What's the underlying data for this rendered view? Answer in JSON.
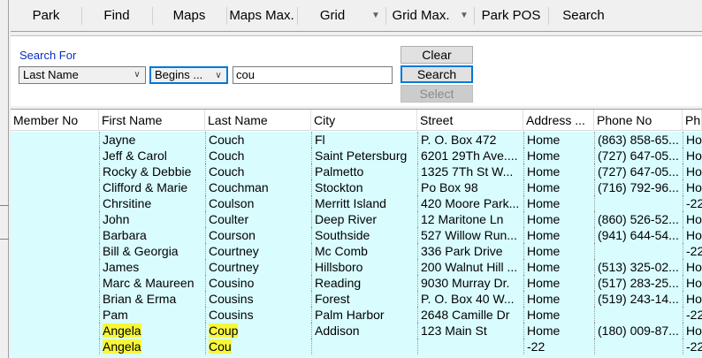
{
  "toolbar": {
    "park": "Park",
    "find": "Find",
    "maps": "Maps",
    "maps_max": "Maps Max.",
    "grid": "Grid",
    "grid_max": "Grid Max.",
    "park_pos": "Park POS",
    "search": "Search"
  },
  "search": {
    "label": "Search For",
    "field": "Last Name",
    "mode": "Begins ...",
    "value": "cou",
    "clear_label": "Clear",
    "search_label": "Search",
    "select_label": "Select"
  },
  "grid": {
    "columns": [
      "Member No",
      "First Name",
      "Last Name",
      "City",
      "Street",
      "Address ...",
      "Phone No",
      "Ph"
    ],
    "rows": [
      {
        "member": "",
        "first": "Jayne",
        "last": "Couch",
        "city": "Fl",
        "street": "P. O. Box 472",
        "addr": "Home",
        "phone": "(863) 858-65...",
        "ph": "Ho",
        "hl_first": false,
        "hl_last": false
      },
      {
        "member": "",
        "first": "Jeff & Carol",
        "last": "Couch",
        "city": "Saint Petersburg",
        "street": "6201 29Th Ave....",
        "addr": "Home",
        "phone": "(727) 647-05...",
        "ph": "Ho",
        "hl_first": false,
        "hl_last": false
      },
      {
        "member": "",
        "first": "Rocky & Debbie",
        "last": "Couch",
        "city": "Palmetto",
        "street": "1325 7Th St W...",
        "addr": "Home",
        "phone": "(727) 647-05...",
        "ph": "Ho",
        "hl_first": false,
        "hl_last": false
      },
      {
        "member": "",
        "first": "Clifford & Marie",
        "last": "Couchman",
        "city": "Stockton",
        "street": "Po Box 98",
        "addr": "Home",
        "phone": "(716) 792-96...",
        "ph": "Ho",
        "hl_first": false,
        "hl_last": false
      },
      {
        "member": "",
        "first": "Chrsitine",
        "last": "Coulson",
        "city": "Merritt Island",
        "street": "420 Moore Park...",
        "addr": "Home",
        "phone": "",
        "ph": "-22",
        "hl_first": false,
        "hl_last": false
      },
      {
        "member": "",
        "first": "John",
        "last": "Coulter",
        "city": "Deep River",
        "street": "12 Maritone Ln",
        "addr": "Home",
        "phone": "(860) 526-52...",
        "ph": "Ho",
        "hl_first": false,
        "hl_last": false
      },
      {
        "member": "",
        "first": "Barbara",
        "last": "Courson",
        "city": "Southside",
        "street": "527 Willow Run...",
        "addr": "Home",
        "phone": "(941) 644-54...",
        "ph": "Ho",
        "hl_first": false,
        "hl_last": false
      },
      {
        "member": "",
        "first": "Bill & Georgia",
        "last": "Courtney",
        "city": "Mc Comb",
        "street": "336 Park Drive",
        "addr": "Home",
        "phone": "",
        "ph": "-22",
        "hl_first": false,
        "hl_last": false
      },
      {
        "member": "",
        "first": "James",
        "last": "Courtney",
        "city": "Hillsboro",
        "street": "200 Walnut Hill ...",
        "addr": "Home",
        "phone": "(513) 325-02...",
        "ph": "Ho",
        "hl_first": false,
        "hl_last": false
      },
      {
        "member": "",
        "first": "Marc & Maureen",
        "last": "Cousino",
        "city": "Reading",
        "street": "9030 Murray Dr.",
        "addr": "Home",
        "phone": "(517) 283-25...",
        "ph": "Ho",
        "hl_first": false,
        "hl_last": false
      },
      {
        "member": "",
        "first": "Brian & Erma",
        "last": "Cousins",
        "city": "Forest",
        "street": "P. O. Box 40 W...",
        "addr": "Home",
        "phone": "(519) 243-14...",
        "ph": "Ho",
        "hl_first": false,
        "hl_last": false
      },
      {
        "member": "",
        "first": "Pam",
        "last": "Cousins",
        "city": "Palm Harbor",
        "street": "2648 Camille Dr",
        "addr": "Home",
        "phone": "",
        "ph": "-22",
        "hl_first": false,
        "hl_last": false
      },
      {
        "member": "",
        "first": "Angela",
        "last": "Coup",
        "city": "Addison",
        "street": "123 Main St",
        "addr": "Home",
        "phone": "(180) 009-87...",
        "ph": "Ho",
        "hl_first": true,
        "hl_last": true
      },
      {
        "member": "",
        "first": "Angela",
        "last": "Cou",
        "city": "",
        "street": "",
        "addr": "-22",
        "phone": "",
        "ph": "-22",
        "hl_first": true,
        "hl_last": true
      }
    ]
  }
}
